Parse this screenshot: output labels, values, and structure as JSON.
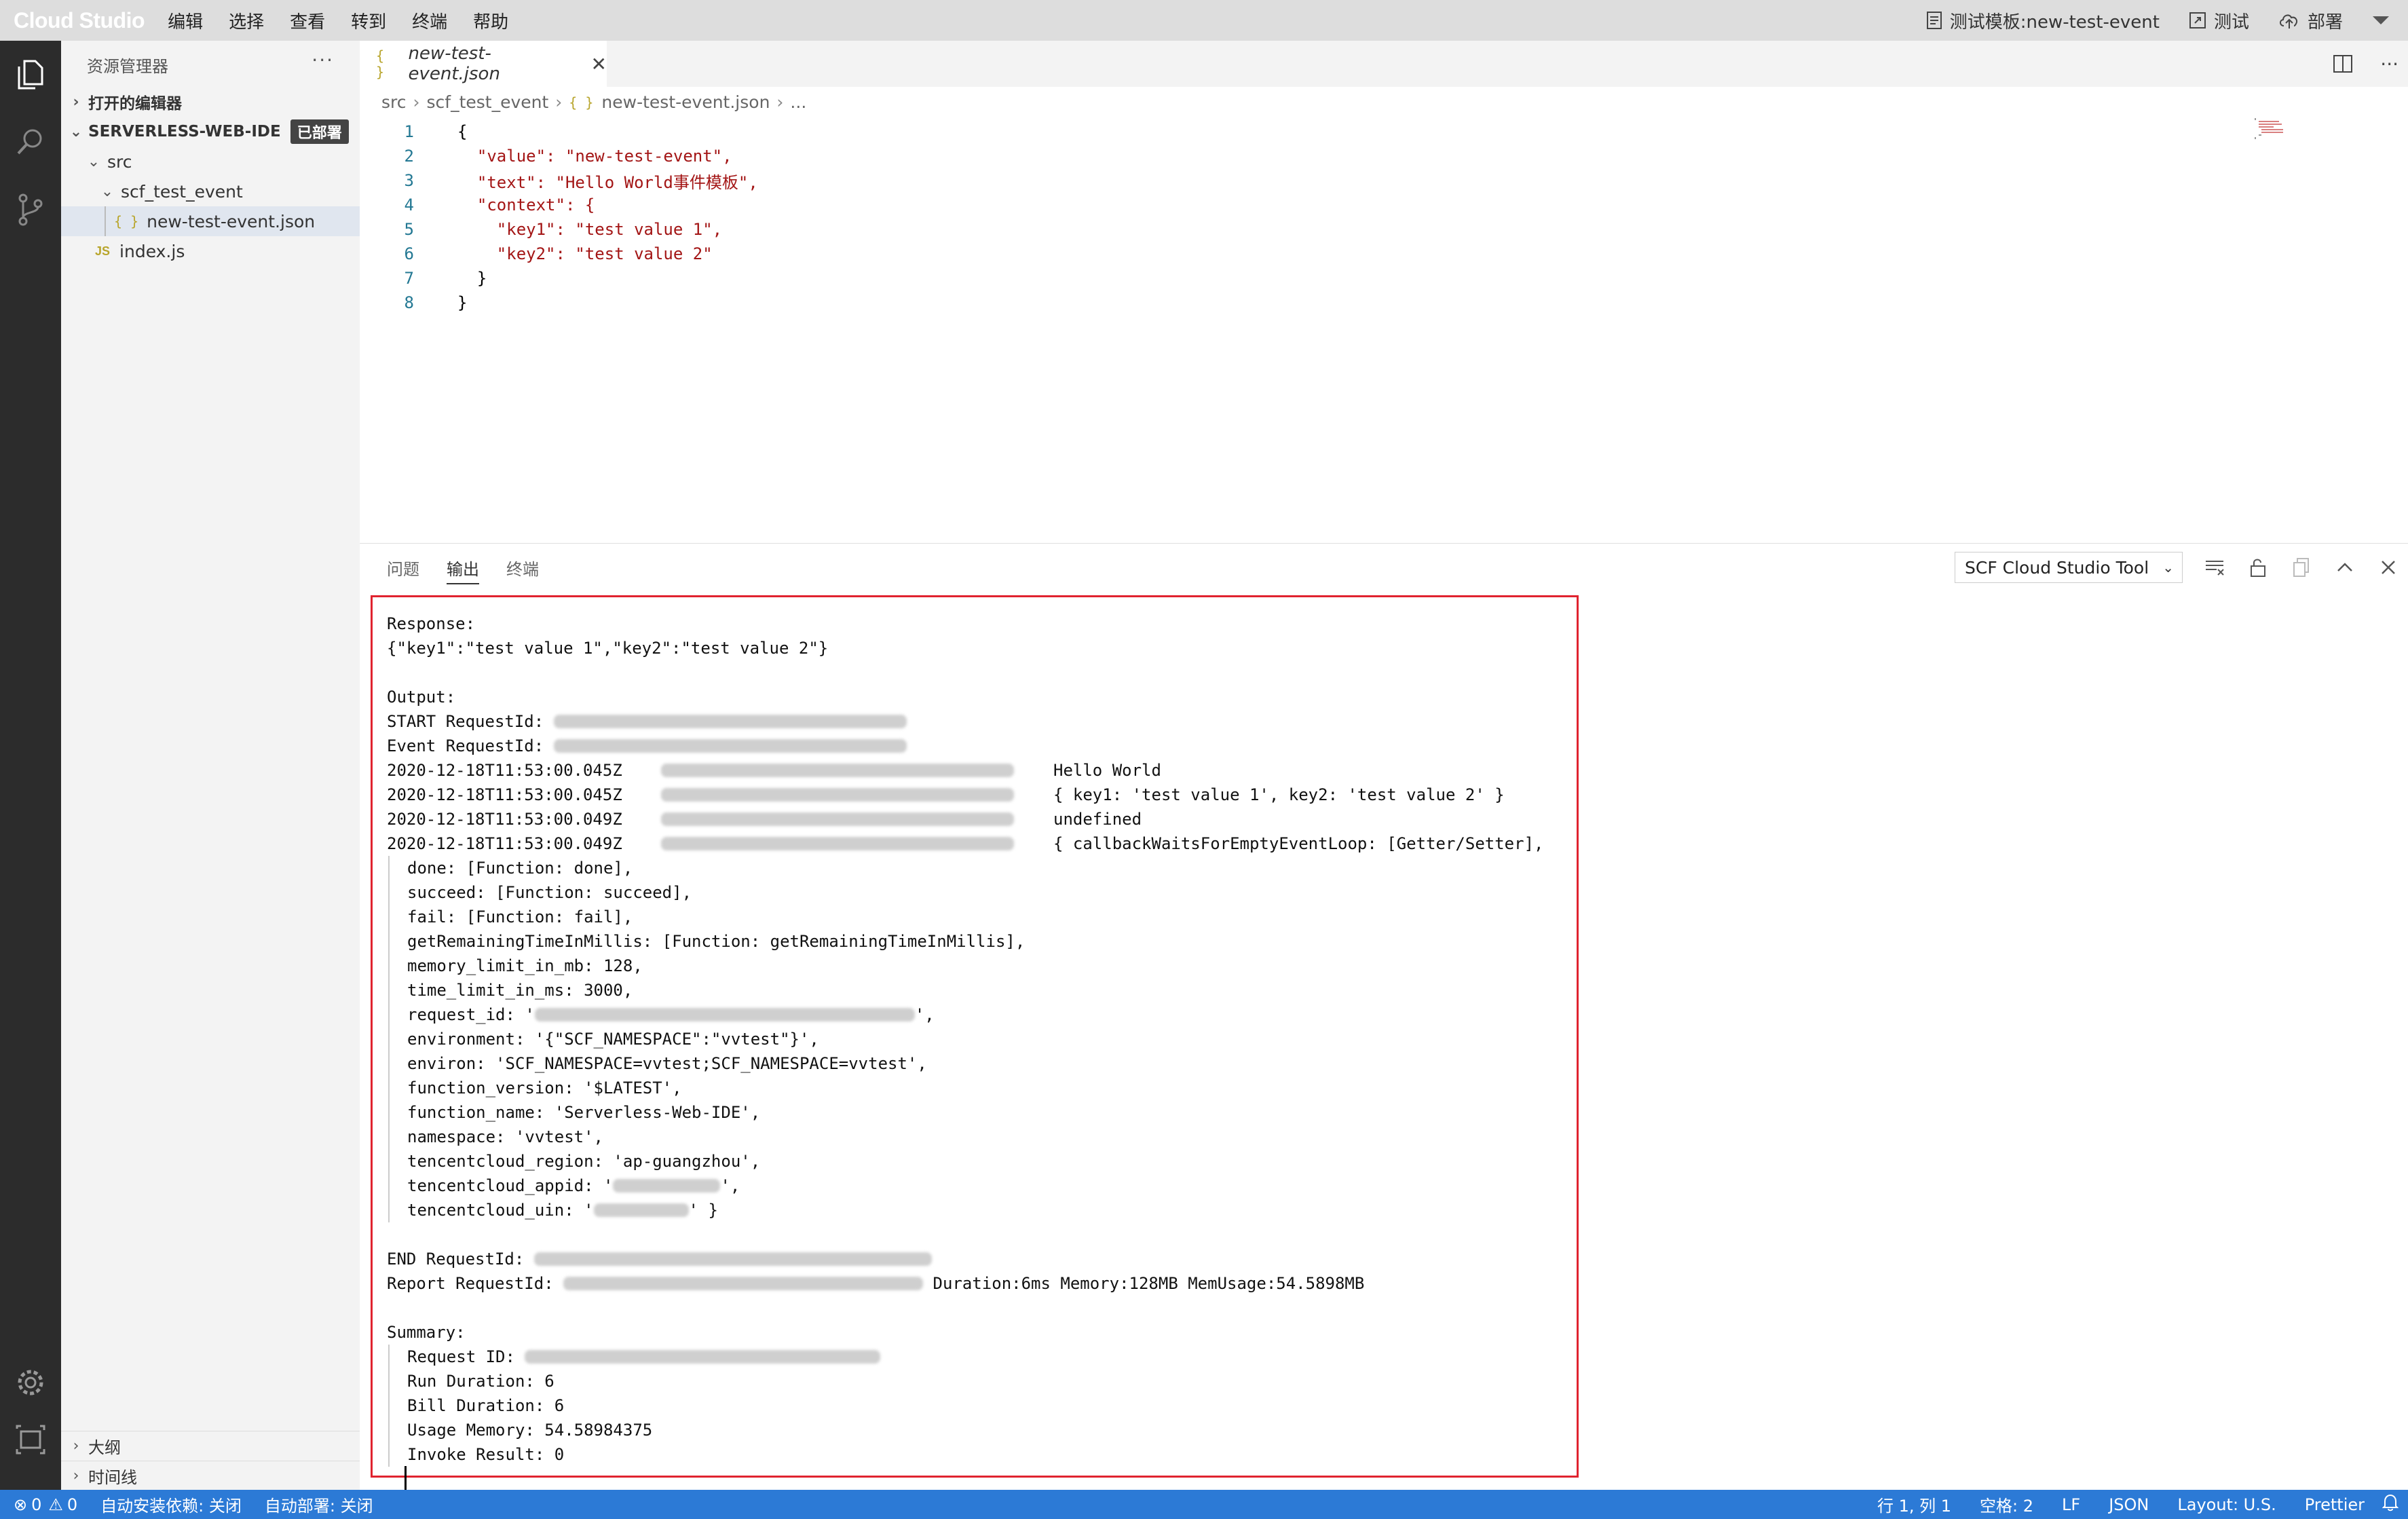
{
  "menubar": {
    "logo": "Cloud Studio",
    "items": [
      "编辑",
      "选择",
      "查看",
      "转到",
      "终端",
      "帮助"
    ],
    "template_label": "测试模板:new-test-event",
    "test_label": "测试",
    "deploy_label": "部署"
  },
  "sidebar": {
    "title": "资源管理器",
    "open_editors": "打开的编辑器",
    "project": "SERVERLESS-WEB-IDE",
    "project_badge": "已部署",
    "folder_src": "src",
    "folder_scf": "scf_test_event",
    "file_json": "new-test-event.json",
    "file_js": "index.js",
    "outline": "大纲",
    "timeline": "时间线"
  },
  "editor": {
    "tab_label": "new-test-event.json",
    "breadcrumb": [
      "src",
      "scf_test_event",
      "new-test-event.json",
      "..."
    ],
    "lines": [
      {
        "n": "1",
        "text": "{"
      },
      {
        "n": "2",
        "text": "  \"value\": \"new-test-event\","
      },
      {
        "n": "3",
        "text": "  \"text\": \"Hello World事件模板\","
      },
      {
        "n": "4",
        "text": "  \"context\": {"
      },
      {
        "n": "5",
        "text": "    \"key1\": \"test value 1\","
      },
      {
        "n": "6",
        "text": "    \"key2\": \"test value 2\""
      },
      {
        "n": "7",
        "text": "  }"
      },
      {
        "n": "8",
        "text": "}"
      }
    ]
  },
  "panel": {
    "tabs": [
      "问题",
      "输出",
      "终端"
    ],
    "active_tab": "输出",
    "channel": "SCF Cloud Studio Tool"
  },
  "output": {
    "response_label": "Response:",
    "response_value": "{\"key1\":\"test value 1\",\"key2\":\"test value 2\"}",
    "output_label": "Output:",
    "start_label": "START RequestId: ",
    "event_label": "Event RequestId: ",
    "log_rows": [
      {
        "ts": "2020-12-18T11:53:00.045Z",
        "msg": "Hello World"
      },
      {
        "ts": "2020-12-18T11:53:00.045Z",
        "msg": "{ key1: 'test value 1', key2: 'test value 2' }"
      },
      {
        "ts": "2020-12-18T11:53:00.049Z",
        "msg": "undefined"
      },
      {
        "ts": "2020-12-18T11:53:00.049Z",
        "msg": "{ callbackWaitsForEmptyEventLoop: [Getter/Setter],"
      }
    ],
    "context_lines": [
      "done: [Function: done],",
      "succeed: [Function: succeed],",
      "fail: [Function: fail],",
      "getRemainingTimeInMillis: [Function: getRemainingTimeInMillis],",
      "memory_limit_in_mb: 128,",
      "time_limit_in_ms: 3000,"
    ],
    "request_id_prefix": "request_id: '",
    "request_id_suffix": "',",
    "context_lines_2": [
      "environment: '{\"SCF_NAMESPACE\":\"vvtest\"}',",
      "environ: 'SCF_NAMESPACE=vvtest;SCF_NAMESPACE=vvtest',",
      "function_version: '$LATEST',",
      "function_name: 'Serverless-Web-IDE',",
      "namespace: 'vvtest',",
      "tencentcloud_region: 'ap-guangzhou',"
    ],
    "appid_prefix": "tencentcloud_appid: '",
    "appid_suffix": "',",
    "uin_prefix": "tencentcloud_uin: '",
    "uin_suffix": "' }",
    "end_label": "END RequestId: ",
    "report_label": "Report RequestId: ",
    "report_stats": " Duration:6ms Memory:128MB MemUsage:54.5898MB",
    "summary_label": "Summary:",
    "summary_request": "Request ID: ",
    "summary_lines": [
      "Run Duration: 6",
      "Bill Duration: 6",
      "Usage Memory: 54.58984375",
      "Invoke Result: 0"
    ]
  },
  "statusbar": {
    "errors": "0",
    "warnings": "0",
    "auto_install": "自动安装依赖: 关闭",
    "auto_deploy": "自动部署: 关闭",
    "position": "行 1, 列 1",
    "spaces": "空格: 2",
    "eol": "LF",
    "language": "JSON",
    "layout": "Layout: U.S.",
    "formatter": "Prettier"
  },
  "colors": {
    "activitybar": "#2c2c2c",
    "statusbar": "#2c7ad6",
    "highlight_box": "#e0232f"
  }
}
